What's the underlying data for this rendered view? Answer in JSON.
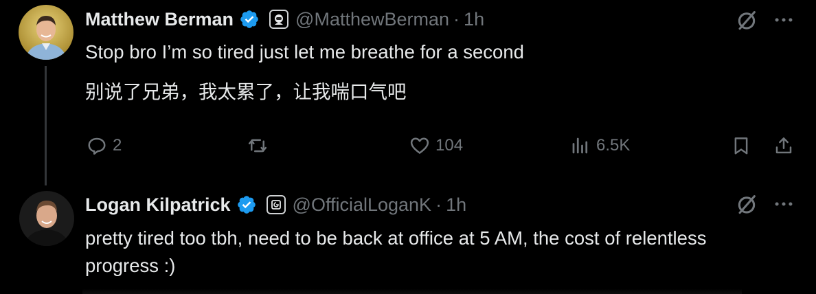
{
  "tweets": [
    {
      "name": "Matthew Berman",
      "handle": "@MatthewBerman",
      "separator": "·",
      "time": "1h",
      "text_en": "Stop bro I’m so tired just let me breathe for a second",
      "text_zh": "别说了兄弟，我太累了，让我喘口气吧",
      "replies": "2",
      "reposts": "",
      "likes": "104",
      "views": "6.5K"
    },
    {
      "name": "Logan Kilpatrick",
      "handle": "@OfficialLoganK",
      "separator": "·",
      "time": "1h",
      "text_line1": "pretty tired too tbh, need to be back at office at 5 AM, the cost of relentless",
      "text_line2": "progress :)"
    }
  ],
  "colors": {
    "background": "#000000",
    "text_primary": "#e7e9ea",
    "text_secondary": "#71767b",
    "verified": "#1d9bf0"
  },
  "icons": [
    "verified-badge-icon",
    "affiliate-badge-icon",
    "grok-icon",
    "more-icon",
    "reply-icon",
    "repost-icon",
    "like-icon",
    "views-icon",
    "bookmark-icon",
    "share-icon"
  ]
}
